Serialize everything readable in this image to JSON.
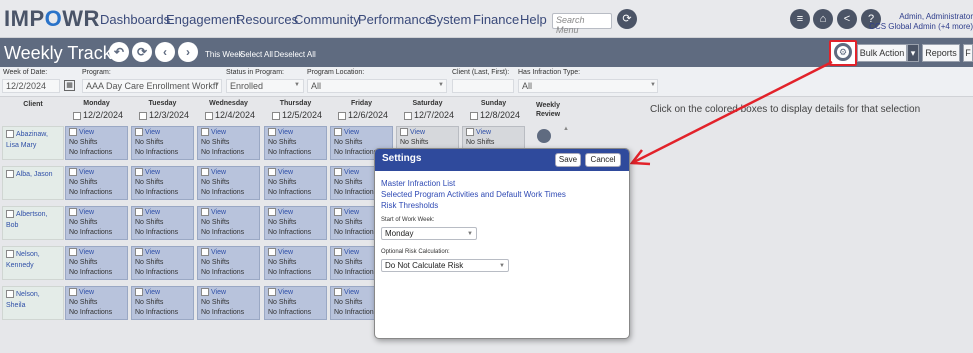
{
  "app": {
    "logo_prefix": "IMP",
    "logo_o": "O",
    "logo_suffix": "WR"
  },
  "nav": {
    "items": [
      "Dashboards",
      "Engagement",
      "Resources",
      "Community",
      "Performance",
      "System",
      "Finance",
      "Help"
    ],
    "search_placeholder": "Search Menu"
  },
  "user": {
    "line1": "Admin, Administrator",
    "line2": "CCS Global Admin (+4 more)"
  },
  "tracker": {
    "title": "Weekly Tracker",
    "this_week": "This Week",
    "select_all": "Select All",
    "deselect_all": "Deselect All",
    "bulk_action": "Bulk Action",
    "reports": "Reports",
    "extra": "F"
  },
  "filters": {
    "week_of_date": {
      "label": "Week of Date:",
      "value": "12/2/2024"
    },
    "program": {
      "label": "Program:",
      "value": "AAA Day Care Enrollment Workfl"
    },
    "status": {
      "label": "Status in Program:",
      "value": "Enrolled"
    },
    "location": {
      "label": "Program Location:",
      "value": "All"
    },
    "client": {
      "label": "Client (Last, First):",
      "value": ""
    },
    "infraction": {
      "label": "Has Infraction Type:",
      "value": "All"
    }
  },
  "grid": {
    "client_header": "Client",
    "review_header": "Weekly Review",
    "days": [
      {
        "name": "Monday",
        "date": "12/2/2024"
      },
      {
        "name": "Tuesday",
        "date": "12/3/2024"
      },
      {
        "name": "Wednesday",
        "date": "12/4/2024"
      },
      {
        "name": "Thursday",
        "date": "12/5/2024"
      },
      {
        "name": "Friday",
        "date": "12/6/2024"
      },
      {
        "name": "Saturday",
        "date": "12/7/2024"
      },
      {
        "name": "Sunday",
        "date": "12/8/2024"
      }
    ],
    "clients": [
      {
        "line1": "Abazinaw,",
        "line2": "Lisa Mary"
      },
      {
        "line1": "Alba, Jason",
        "line2": ""
      },
      {
        "line1": "Albertson,",
        "line2": "Bob"
      },
      {
        "line1": "Nelson,",
        "line2": "Kennedy"
      },
      {
        "line1": "Nelson, Sheila",
        "line2": ""
      }
    ],
    "cell_view": "View",
    "cell_shifts": "No Shifts",
    "cell_infractions": "No Infractions"
  },
  "info_text": "Click on the colored boxes to display details for that selection",
  "settings_modal": {
    "title": "Settings",
    "save": "Save",
    "cancel": "Cancel",
    "links": [
      "Master Infraction List",
      "Selected Program Activities and Default Work Times",
      "Risk Thresholds"
    ],
    "start_of_week": {
      "label": "Start of Work Week:",
      "value": "Monday"
    },
    "risk_calc": {
      "label": "Optional Risk Calculation:",
      "value": "Do Not Calculate Risk"
    }
  },
  "colors": {
    "nav_bg": "#e8e9ec",
    "titlebar": "#5f6b80",
    "modal_header": "#2f4a9c",
    "cell_blue": "#b8c3dc",
    "highlight_red": "#e2222a"
  }
}
